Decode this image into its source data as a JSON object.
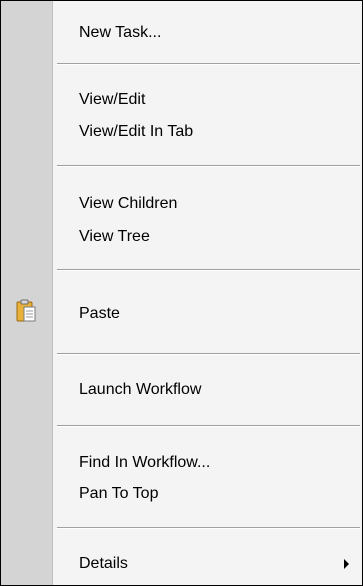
{
  "menu": {
    "items": [
      {
        "label": "New Task..."
      },
      {
        "label": "View/Edit"
      },
      {
        "label": "View/Edit In Tab"
      },
      {
        "label": "View Children"
      },
      {
        "label": "View Tree"
      },
      {
        "label": "Paste",
        "icon": "clipboard-paste-icon"
      },
      {
        "label": "Launch Workflow"
      },
      {
        "label": "Find In Workflow..."
      },
      {
        "label": "Pan To Top"
      },
      {
        "label": "Details",
        "submenu": true
      }
    ]
  },
  "colors": {
    "menu_background": "#f4f4f4",
    "gutter": "#d4d4d4",
    "separator": "#a0a0a0",
    "border": "#000000"
  }
}
